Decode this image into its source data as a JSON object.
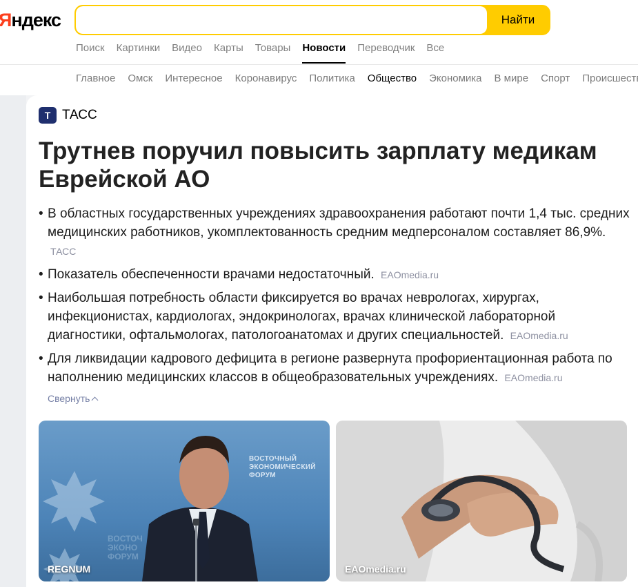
{
  "header": {
    "logo_first": "Я",
    "logo_rest": "ндекс",
    "search_placeholder": "",
    "search_button": "Найти",
    "service_tabs": [
      {
        "label": "Поиск",
        "active": false
      },
      {
        "label": "Картинки",
        "active": false
      },
      {
        "label": "Видео",
        "active": false
      },
      {
        "label": "Карты",
        "active": false
      },
      {
        "label": "Товары",
        "active": false
      },
      {
        "label": "Новости",
        "active": true
      },
      {
        "label": "Переводчик",
        "active": false
      },
      {
        "label": "Все",
        "active": false
      }
    ],
    "rubrics": [
      {
        "label": "Главное",
        "active": false
      },
      {
        "label": "Омск",
        "active": false
      },
      {
        "label": "Интересное",
        "active": false
      },
      {
        "label": "Коронавирус",
        "active": false
      },
      {
        "label": "Политика",
        "active": false
      },
      {
        "label": "Общество",
        "active": true
      },
      {
        "label": "Экономика",
        "active": false
      },
      {
        "label": "В мире",
        "active": false
      },
      {
        "label": "Спорт",
        "active": false
      },
      {
        "label": "Происшествия",
        "active": false
      }
    ]
  },
  "story": {
    "source_logo_letter": "Т",
    "source_name": "ТАСС",
    "title": "Трутнев поручил повысить зарплату медикам Еврейской АО",
    "bullets": [
      {
        "text": "В областных государственных учреждениях здравоохранения работают почти 1,4 тыс. средних медицинских работников, укомплектованность средним медперсоналом составляет 86,9%.",
        "agency": "ТАСС"
      },
      {
        "text": "Показатель обеспеченности врачами недостаточный.",
        "agency": "EAOmedia.ru"
      },
      {
        "text": "Наибольшая потребность области фиксируется во врачах неврологах, хирургах, инфекционистах, кардиологах, эндокринологах, врачах клинической лабораторной диагностики, офтальмологах, патологоанатомах и других специальностей.",
        "agency": "EAOmedia.ru"
      },
      {
        "text": "Для ликвидации кадрового дефицита в регионе развернута профориентационная работа по наполнению медицинских классов в общеобразовательных учреждениях.",
        "agency": "EAOmedia.ru"
      }
    ],
    "collapse_label": "Свернуть",
    "photos": [
      {
        "caption": "REGNUM",
        "backdrop_text": "ВОСТОЧНЫЙ ЭКОНОМИЧЕСКИЙ ФОРУМ"
      },
      {
        "caption": "EAOmedia.ru"
      }
    ]
  },
  "colors": {
    "brand_red": "#fc3f1d",
    "search_yellow": "#ffcc00",
    "tass_blue": "#1f2f6e",
    "link_blue": "#7680a6"
  }
}
